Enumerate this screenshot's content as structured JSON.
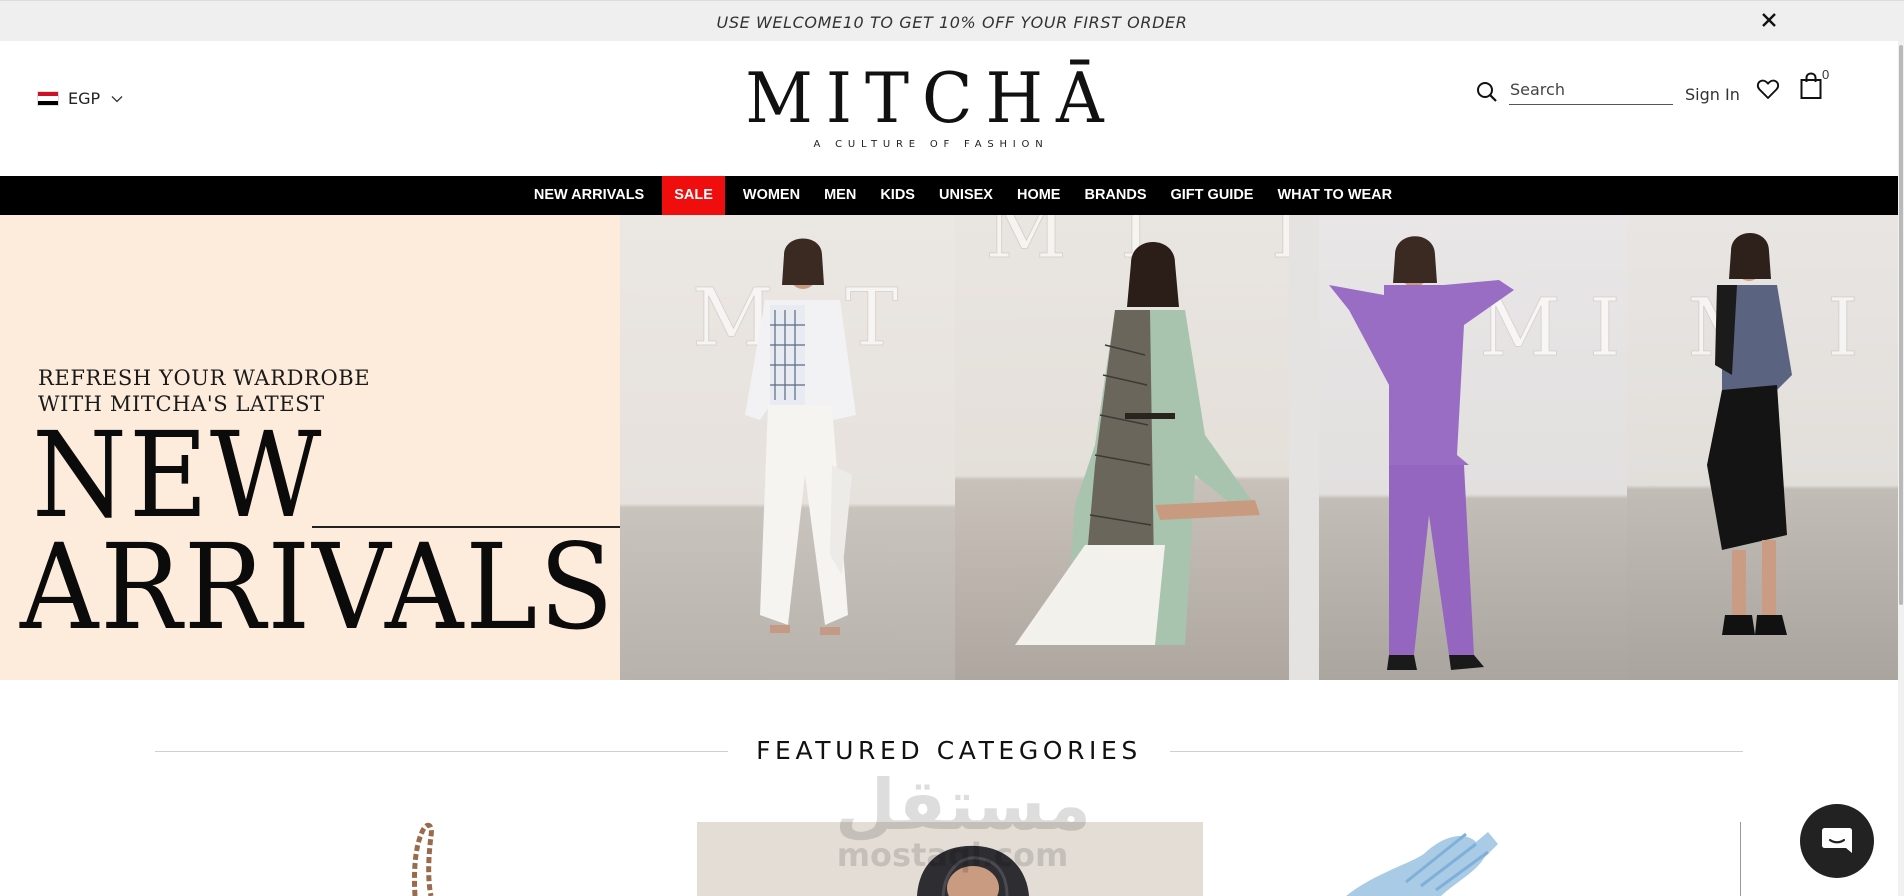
{
  "announcement": {
    "text": "USE WELCOME10 TO GET 10% OFF YOUR FIRST ORDER",
    "close_icon": "close-icon"
  },
  "header": {
    "currency": {
      "code": "EGP",
      "flag_colors": [
        "#ce1126",
        "#ffffff",
        "#000000"
      ]
    },
    "logo": {
      "wordmark": "MITCHĀ",
      "tagline": "A CULTURE OF FASHION"
    },
    "search": {
      "placeholder": "Search",
      "icon": "search-icon"
    },
    "signin_label": "Sign In",
    "wishlist_icon": "heart-icon",
    "cart": {
      "icon": "shopping-bag-icon",
      "count": "0"
    }
  },
  "nav": {
    "items": [
      {
        "label": "NEW ARRIVALS"
      },
      {
        "label": "SALE",
        "highlight": "#f00d0d"
      },
      {
        "label": "WOMEN"
      },
      {
        "label": "MEN"
      },
      {
        "label": "KIDS"
      },
      {
        "label": "UNISEX"
      },
      {
        "label": "HOME"
      },
      {
        "label": "BRANDS"
      },
      {
        "label": "GIFT GUIDE"
      },
      {
        "label": "WHAT TO WEAR"
      }
    ]
  },
  "hero": {
    "subtitle_line1": "REFRESH YOUR WARDROBE",
    "subtitle_line2": "WITH MITCHA'S LATEST",
    "title_line1": "NEW",
    "title_line2": "ARRIVALS",
    "background": "#fdecdc"
  },
  "featured": {
    "title": "FEATURED CATEGORIES"
  },
  "watermark": {
    "arabic": "مستقل",
    "latin": "mostaql.com"
  },
  "chat": {
    "icon": "chat-icon"
  }
}
